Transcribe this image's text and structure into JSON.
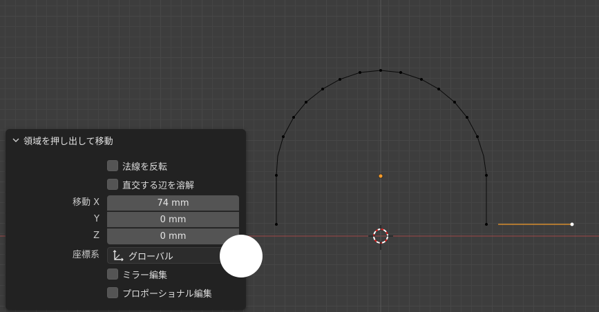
{
  "panel": {
    "title": "領域を押し出して移動",
    "flip_normals_label": "法線を反転",
    "dissolve_label": "直交する辺を溶解",
    "move_label": "移動 X",
    "y_label": "Y",
    "z_label": "Z",
    "move_x": "74 mm",
    "move_y": "0 mm",
    "move_z": "0 mm",
    "orientation_label": "座標系",
    "orientation_value": "グローバル",
    "mirror_label": "ミラー編集",
    "proportional_label": "プロポーショナル編集"
  },
  "icons": [
    "chevron-down-icon",
    "orientation-axes-icon",
    "3d-cursor-icon"
  ],
  "colors": {
    "grid_background": "#3d3d3d",
    "panel_background": "#222222",
    "field_background": "#545454",
    "x_axis": "#a04848",
    "selection_orange": "#f39a2b",
    "vertex_black": "#000000"
  }
}
